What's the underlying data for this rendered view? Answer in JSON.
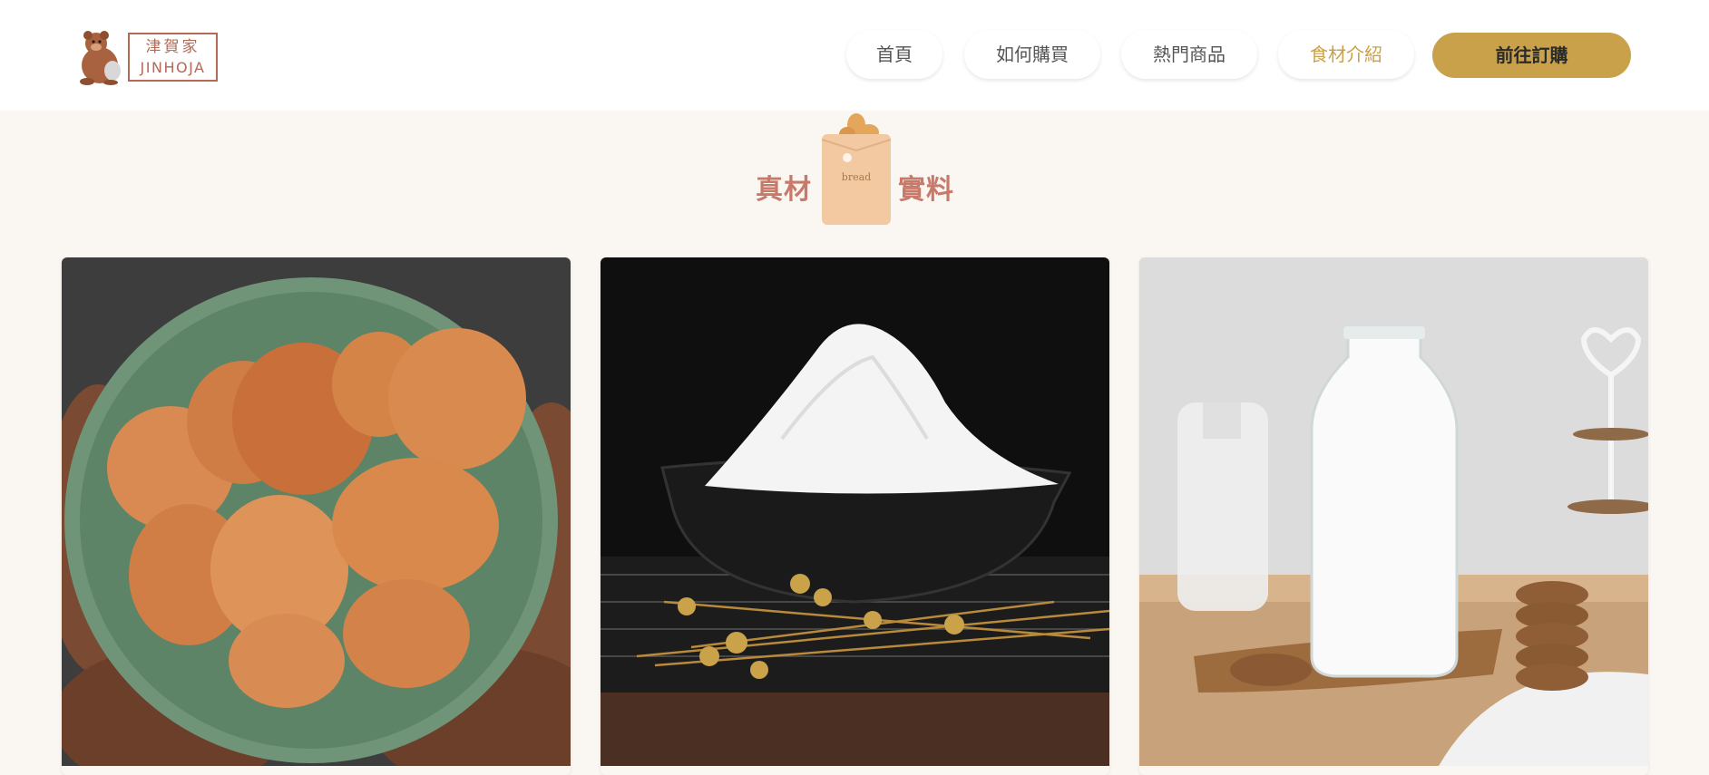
{
  "brand": {
    "name_cn": "津賀家",
    "name_en": "JINHOJA",
    "logo_icon": "bear-icon"
  },
  "nav": {
    "items": [
      {
        "label": "首頁",
        "active": false
      },
      {
        "label": "如何購買",
        "active": false
      },
      {
        "label": "熱門商品",
        "active": false
      },
      {
        "label": "食材介紹",
        "active": true
      }
    ],
    "order_button": "前往訂購"
  },
  "section": {
    "title_left": "真材",
    "title_right": "實料",
    "bag_text": "bread",
    "bag_icon": "bread-bag-icon"
  },
  "cards": [
    {
      "subject": "eggs",
      "icon": "eggs-bowl-photo"
    },
    {
      "subject": "flour",
      "icon": "flour-bowl-photo"
    },
    {
      "subject": "milk",
      "icon": "milk-bottle-photo"
    }
  ],
  "colors": {
    "accent": "#c9a14a",
    "logo": "#b36a56",
    "title": "#c87a6a",
    "background": "#faf7f3"
  }
}
